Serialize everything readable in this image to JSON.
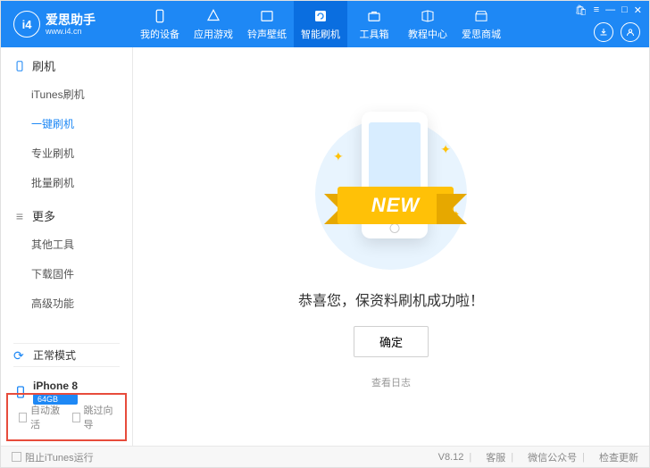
{
  "brand": {
    "title": "爱思助手",
    "sub": "www.i4.cn",
    "logo": "i4"
  },
  "tabs": [
    {
      "name": "device",
      "label": "我的设备"
    },
    {
      "name": "games",
      "label": "应用游戏"
    },
    {
      "name": "ring",
      "label": "铃声壁纸"
    },
    {
      "name": "flash",
      "label": "智能刷机"
    },
    {
      "name": "tool",
      "label": "工具箱"
    },
    {
      "name": "course",
      "label": "教程中心"
    },
    {
      "name": "store",
      "label": "爱思商城"
    }
  ],
  "active_tab": "flash",
  "sidebar": {
    "groups": [
      {
        "title": "刷机",
        "items": [
          "iTunes刷机",
          "一键刷机",
          "专业刷机",
          "批量刷机"
        ],
        "active": "一键刷机"
      },
      {
        "title": "更多",
        "items": [
          "其他工具",
          "下载固件",
          "高级功能"
        ],
        "active": ""
      }
    ],
    "mode": "正常模式",
    "device": {
      "name": "iPhone 8",
      "badge": "64GB"
    },
    "checks": {
      "auto_activate": "自动激活",
      "skip_wizard": "跳过向导"
    }
  },
  "main": {
    "ribbon": "NEW",
    "message": "恭喜您，保资料刷机成功啦！",
    "confirm": "确定",
    "log_link": "查看日志"
  },
  "footer": {
    "block_itunes": "阻止iTunes运行",
    "version": "V8.12",
    "support": "客服",
    "wechat": "微信公众号",
    "update": "检查更新"
  }
}
